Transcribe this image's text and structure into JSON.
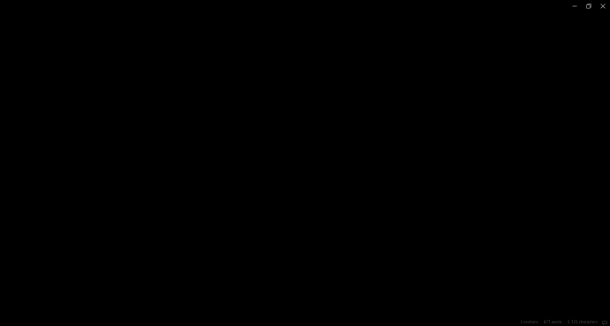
{
  "window": {
    "controls": [
      {
        "name": "minimize",
        "icon": "minimize-icon"
      },
      {
        "name": "restore",
        "icon": "restore-icon"
      },
      {
        "name": "close",
        "icon": "close-icon"
      }
    ],
    "background": "#000000"
  },
  "status_bar": {
    "sections_label": "3 sections",
    "words_label": "877 words",
    "characters_label": "5 725 characters",
    "separator": "·",
    "right_icon": "comment-icon",
    "text_color": "#4a4a4a"
  }
}
